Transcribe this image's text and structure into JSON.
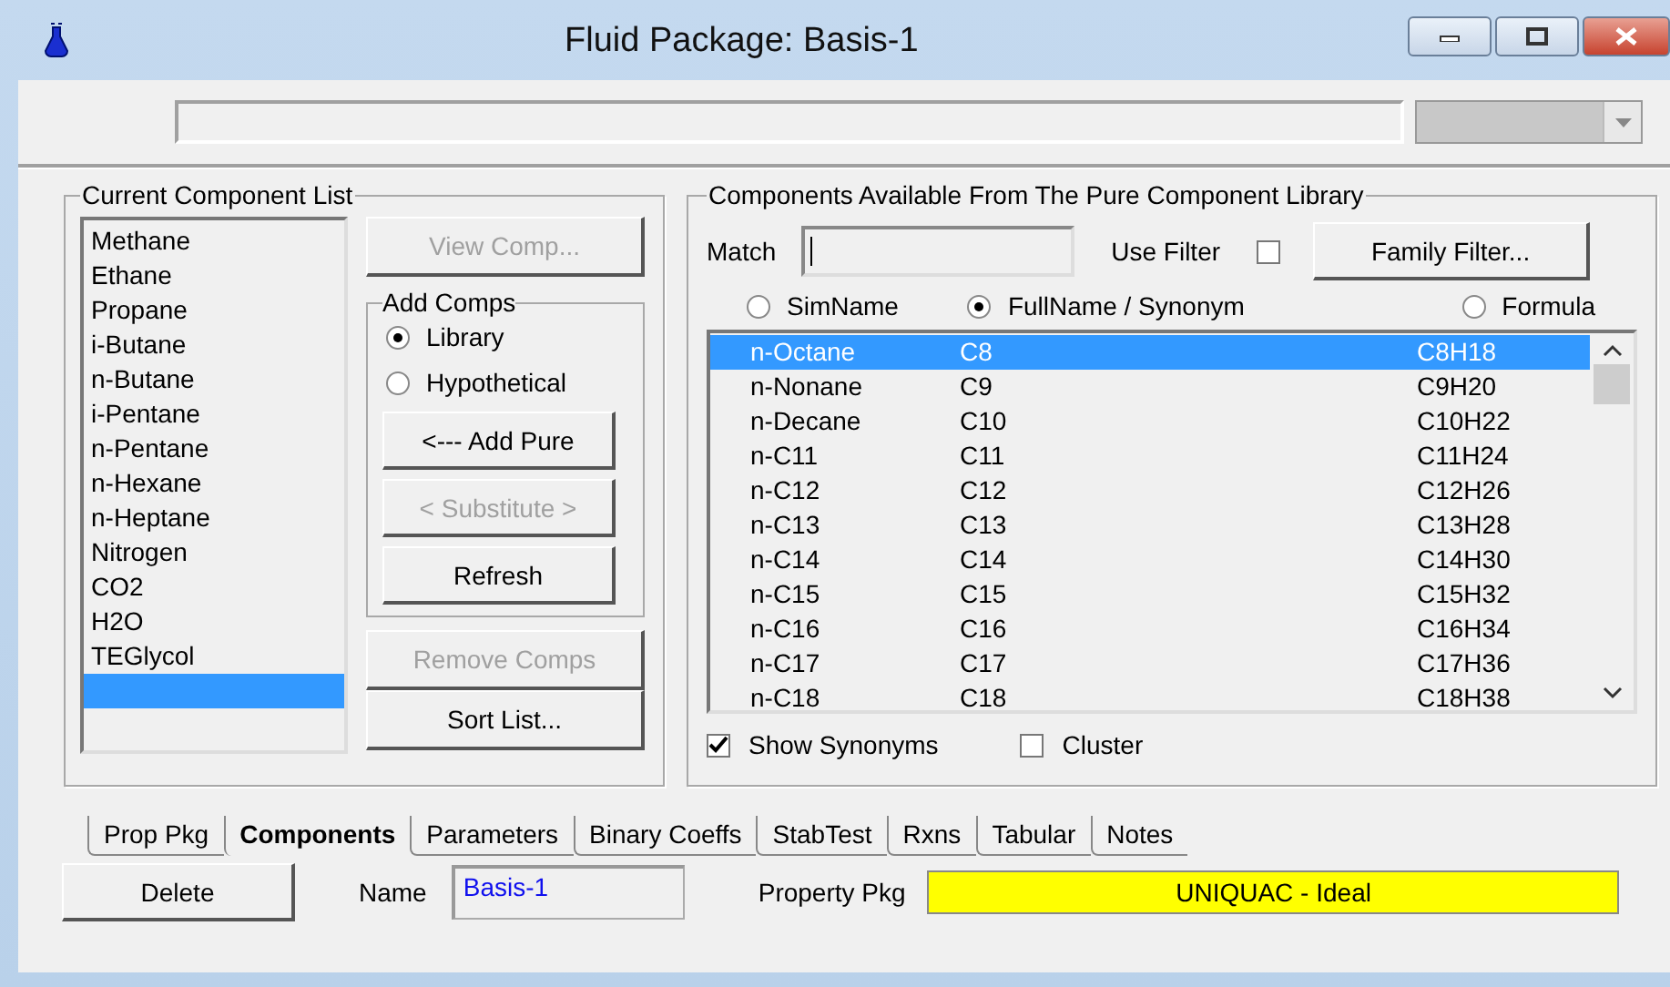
{
  "window": {
    "title": "Fluid Package: Basis-1"
  },
  "current_list": {
    "title": "Current Component List",
    "items": [
      {
        "label": "Methane",
        "selected": false
      },
      {
        "label": "Ethane",
        "selected": false
      },
      {
        "label": "Propane",
        "selected": false
      },
      {
        "label": "i-Butane",
        "selected": false
      },
      {
        "label": "n-Butane",
        "selected": false
      },
      {
        "label": "i-Pentane",
        "selected": false
      },
      {
        "label": "n-Pentane",
        "selected": false
      },
      {
        "label": "n-Hexane",
        "selected": false
      },
      {
        "label": "n-Heptane",
        "selected": false
      },
      {
        "label": "Nitrogen",
        "selected": false
      },
      {
        "label": "CO2",
        "selected": false
      },
      {
        "label": "H2O",
        "selected": false
      },
      {
        "label": "TEGlycol",
        "selected": false
      }
    ],
    "blank_row_selected": true
  },
  "view_button": {
    "label": "View Comp...",
    "disabled": true
  },
  "add_comps": {
    "title": "Add Comps",
    "options": [
      {
        "label": "Library",
        "selected": true
      },
      {
        "label": "Hypothetical",
        "selected": false
      }
    ],
    "buttons": [
      {
        "label": "<--- Add Pure",
        "disabled": false
      },
      {
        "label": "< Substitute >",
        "disabled": true
      },
      {
        "label": "Refresh",
        "disabled": false
      }
    ]
  },
  "lower_buttons": [
    {
      "label": "Remove Comps",
      "disabled": true
    },
    {
      "label": "Sort List...",
      "disabled": false
    }
  ],
  "library": {
    "title": "Components Available From The Pure Component Library",
    "match_label": "Match",
    "use_filter_label": "Use Filter",
    "use_filter_checked": false,
    "family_filter": "Family Filter...",
    "modes": [
      {
        "label": "SimName",
        "selected": false
      },
      {
        "label": "FullName / Synonym",
        "selected": true
      },
      {
        "label": "Formula",
        "selected": false
      }
    ],
    "rows": [
      {
        "name": "n-Octane",
        "synonym": "C8",
        "formula": "C8H18",
        "selected": true
      },
      {
        "name": "n-Nonane",
        "synonym": "C9",
        "formula": "C9H20",
        "selected": false
      },
      {
        "name": "n-Decane",
        "synonym": "C10",
        "formula": "C10H22",
        "selected": false
      },
      {
        "name": "n-C11",
        "synonym": "C11",
        "formula": "C11H24",
        "selected": false
      },
      {
        "name": "n-C12",
        "synonym": "C12",
        "formula": "C12H26",
        "selected": false
      },
      {
        "name": "n-C13",
        "synonym": "C13",
        "formula": "C13H28",
        "selected": false
      },
      {
        "name": "n-C14",
        "synonym": "C14",
        "formula": "C14H30",
        "selected": false
      },
      {
        "name": "n-C15",
        "synonym": "C15",
        "formula": "C15H32",
        "selected": false
      },
      {
        "name": "n-C16",
        "synonym": "C16",
        "formula": "C16H34",
        "selected": false
      },
      {
        "name": "n-C17",
        "synonym": "C17",
        "formula": "C17H36",
        "selected": false
      },
      {
        "name": "n-C18",
        "synonym": "C18",
        "formula": "C18H38",
        "selected": false
      }
    ],
    "options": [
      {
        "label": "Show Synonyms",
        "checked": true
      },
      {
        "label": "Cluster",
        "checked": false
      }
    ]
  },
  "tabs": [
    {
      "label": "Prop Pkg",
      "selected": false
    },
    {
      "label": "Components",
      "selected": true
    },
    {
      "label": "Parameters",
      "selected": false
    },
    {
      "label": "Binary Coeffs",
      "selected": false
    },
    {
      "label": "StabTest",
      "selected": false
    },
    {
      "label": "Rxns",
      "selected": false
    },
    {
      "label": "Tabular",
      "selected": false
    },
    {
      "label": "Notes",
      "selected": false
    }
  ],
  "footer": {
    "delete": "Delete",
    "name_label": "Name",
    "name_value": "Basis-1",
    "pkg_label": "Property Pkg",
    "pkg_value": "UNIQUAC - Ideal"
  }
}
